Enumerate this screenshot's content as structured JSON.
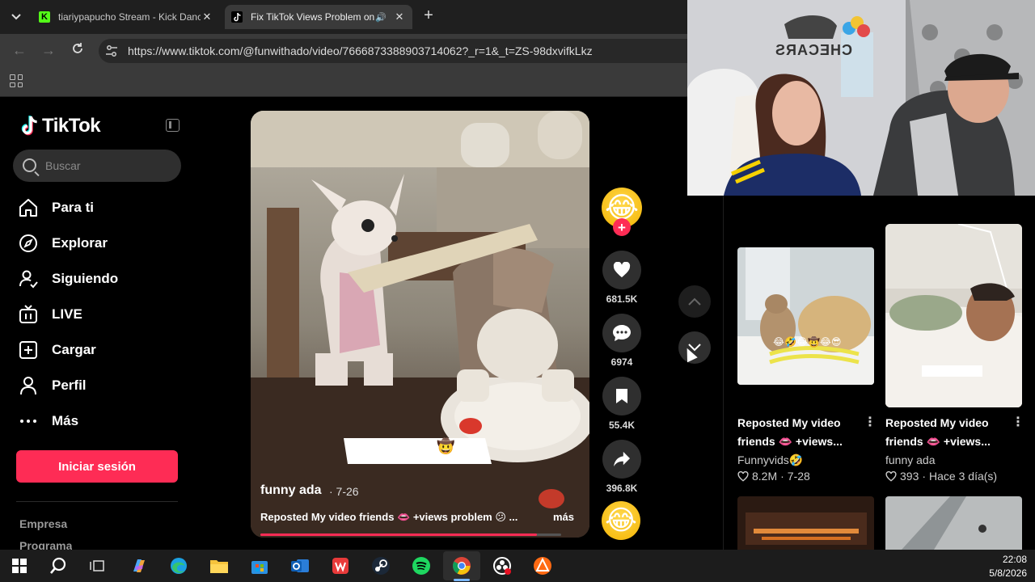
{
  "browser": {
    "tabs": [
      {
        "title": "tiariypapucho Stream - Kick Danc",
        "favicon": "K",
        "active": false
      },
      {
        "title": "Fix TikTok Views Problem on",
        "favicon": "tiktok-icon",
        "active": true
      }
    ],
    "url": "https://www.tiktok.com/@funwithado/video/7666873388903714062?_r=1&_t=ZS-98dxvifkLkz"
  },
  "tiktok": {
    "logo_text": "TikTok",
    "search_placeholder": "Buscar",
    "nav": [
      {
        "label": "Para ti",
        "icon": "home-icon"
      },
      {
        "label": "Explorar",
        "icon": "compass-icon"
      },
      {
        "label": "Siguiendo",
        "icon": "following-icon"
      },
      {
        "label": "LIVE",
        "icon": "live-tv-icon"
      },
      {
        "label": "Cargar",
        "icon": "upload-icon"
      },
      {
        "label": "Perfil",
        "icon": "profile-icon"
      },
      {
        "label": "Más",
        "icon": "more-icon"
      }
    ],
    "login_button": "Iniciar sesión",
    "footer_links": [
      "Empresa",
      "Programa"
    ]
  },
  "video": {
    "author": "funny ada",
    "date": "· 7-26",
    "caption": "Reposted My video friends 👄 +views problem 😕 ...",
    "more": "más",
    "overlay_emojis": "😂😀😁😄🤠",
    "progress": 0.92,
    "likes": "681.5K",
    "comments": "6974",
    "saves": "55.4K",
    "shares": "396.8K"
  },
  "related": [
    {
      "title": "Reposted My video friends 👄 +views...",
      "author": "Funnyvids🤣",
      "views": "8.2M",
      "date": "7-28",
      "overlay": "😂🤣😂🤠😂😎"
    },
    {
      "title": "Reposted My video friends 👄 +views...",
      "author": "funny ada",
      "views": "393",
      "date": "Hace 3 día(s)"
    }
  ],
  "webcam": {
    "wall_sign": "CHECARS"
  },
  "taskbar": {
    "time": "22:08",
    "date": "5/8/2026"
  },
  "colors": {
    "accent": "#fe2c55",
    "background": "#000000"
  }
}
